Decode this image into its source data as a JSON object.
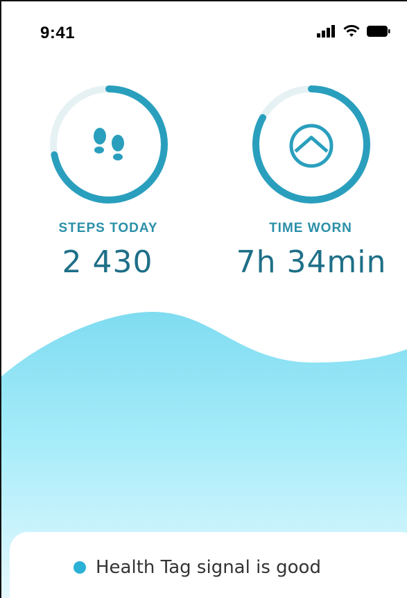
{
  "status_bar": {
    "time": "9:41",
    "icons": [
      "cellular-signal-icon",
      "wifi-icon",
      "battery-icon"
    ]
  },
  "metrics": [
    {
      "icon": "footprints-icon",
      "label": "STEPS TODAY",
      "value": "2 430",
      "progress": 0.72
    },
    {
      "icon": "activity-arc-icon",
      "label": "TIME WORN",
      "value": "7h 34min",
      "progress": 0.83
    }
  ],
  "signal": {
    "text": "Health Tag signal is good",
    "status_color": "#2bb1d6"
  },
  "colors": {
    "accent": "#2a9fbd",
    "ring_track": "#e6f1f4",
    "wave_top": "#7fdcf0",
    "wave_bottom": "#e6f9fd"
  }
}
